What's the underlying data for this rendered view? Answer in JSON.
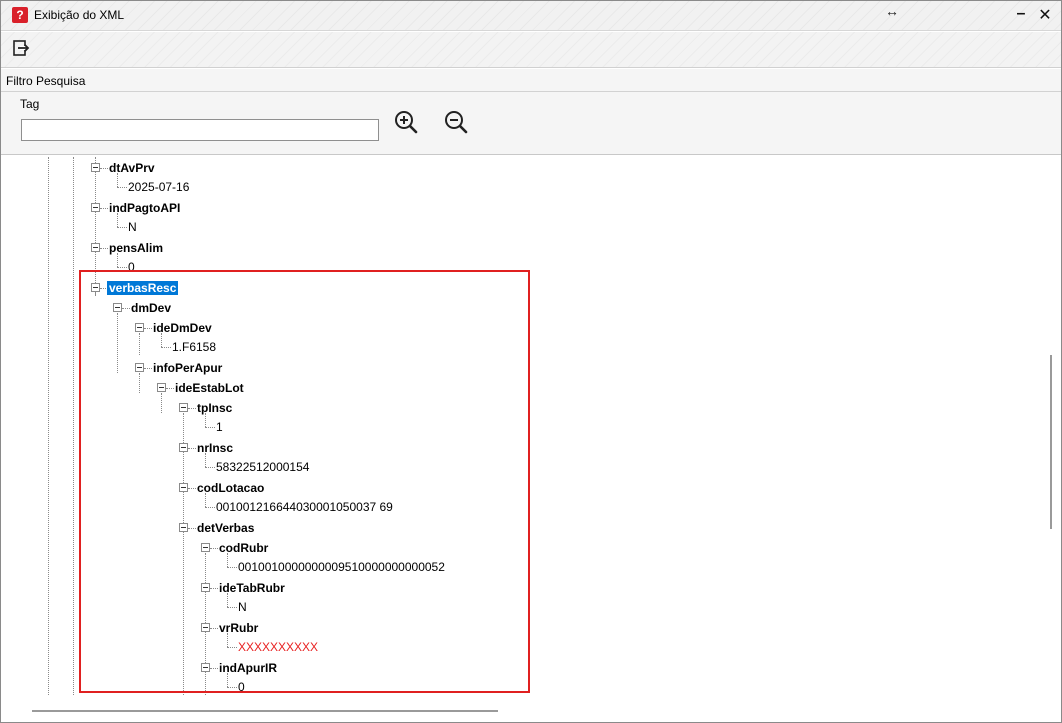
{
  "window": {
    "title": "Exibição do XML",
    "logo_text": "?",
    "accent_color": "#d9202a"
  },
  "toolbar": {
    "exit_icon": "exit-icon"
  },
  "filter": {
    "section_title": "Filtro Pesquisa",
    "tag_label": "Tag",
    "tag_value": "",
    "zoom_in_icon": "zoom-in-icon",
    "zoom_out_icon": "zoom-out-icon"
  },
  "tree": {
    "nodes": [
      {
        "tag": "dtAvPrv",
        "value": "2025-07-16"
      },
      {
        "tag": "indPagtoAPI",
        "value": "N"
      },
      {
        "tag": "pensAlim",
        "value": "0"
      },
      {
        "tag": "verbasResc",
        "selected": true
      },
      {
        "tag": "dmDev"
      },
      {
        "tag": "ideDmDev",
        "value": "1.F6158"
      },
      {
        "tag": "infoPerApur"
      },
      {
        "tag": "ideEstabLot"
      },
      {
        "tag": "tpInsc",
        "value": "1"
      },
      {
        "tag": "nrInsc",
        "value": "58322512000154"
      },
      {
        "tag": "codLotacao",
        "value": "001001216644030001050037 69"
      },
      {
        "tag": "detVerbas"
      },
      {
        "tag": "codRubr",
        "value": "0010010000000009510000000000052"
      },
      {
        "tag": "ideTabRubr",
        "value": "N"
      },
      {
        "tag": "vrRubr",
        "value": "XXXXXXXXXX"
      },
      {
        "tag": "indApurIR",
        "value": "0"
      }
    ]
  },
  "colors": {
    "selection": "#0078d7",
    "highlight_border": "#e02020",
    "masked_value": "#e82020"
  }
}
